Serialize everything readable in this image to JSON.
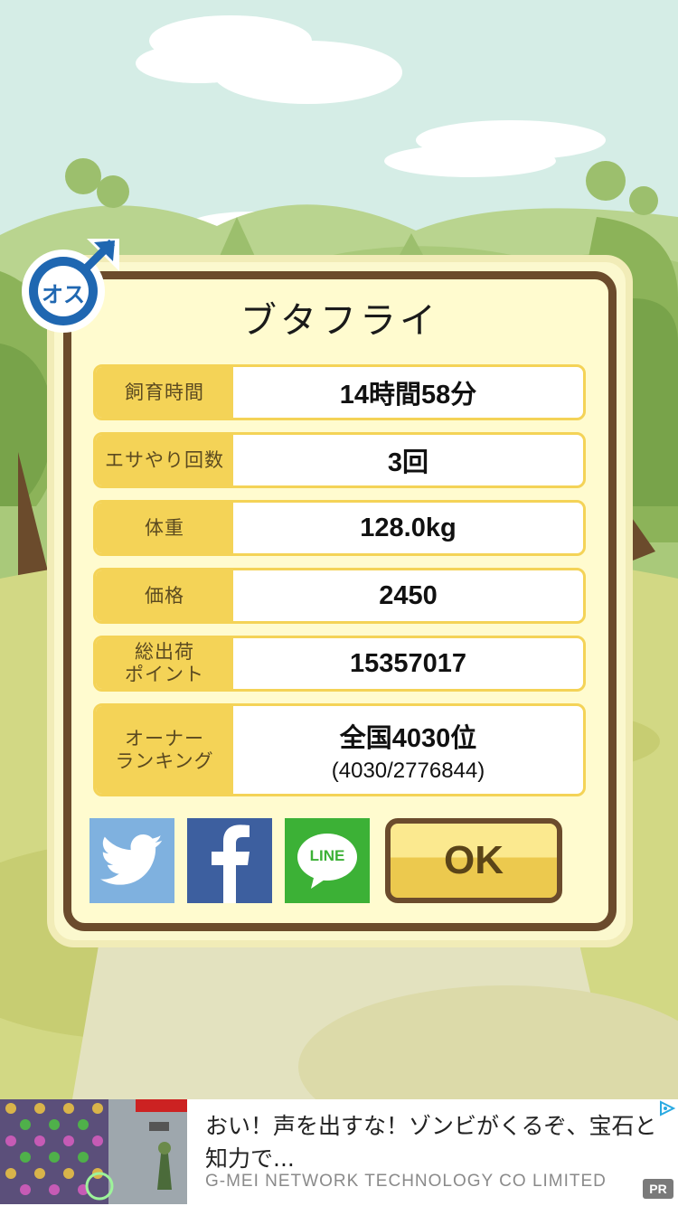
{
  "pig": {
    "name": "ブタフライ",
    "gender_label": "オス",
    "gender_icon": "male-symbol-icon"
  },
  "stats": [
    {
      "label": "飼育時間",
      "value": "14時間58分"
    },
    {
      "label": "エサやり回数",
      "value": "3回"
    },
    {
      "label": "体重",
      "value": "128.0kg"
    },
    {
      "label": "価格",
      "value": "2450"
    },
    {
      "label": "総出荷\nポイント",
      "value": "15357017"
    },
    {
      "label": "オーナー\nランキング",
      "value": "全国4030位",
      "sub": "(4030/2776844)"
    }
  ],
  "share": {
    "twitter_icon": "twitter-bird-icon",
    "facebook_icon": "facebook-f-icon",
    "line_label": "LINE"
  },
  "ok_label": "OK",
  "ad": {
    "text": "おい！声を出すな！ゾンビがくるぞ、宝石と知力で...",
    "company": "G-MEI NETWORK TECHNOLOGY CO LIMITED",
    "pr_label": "PR"
  },
  "colors": {
    "dialog_border": "#6b4b2c",
    "label_bg": "#f4d357",
    "twitter": "#7fb1df",
    "facebook": "#3d5f9f",
    "line": "#3cb136"
  }
}
